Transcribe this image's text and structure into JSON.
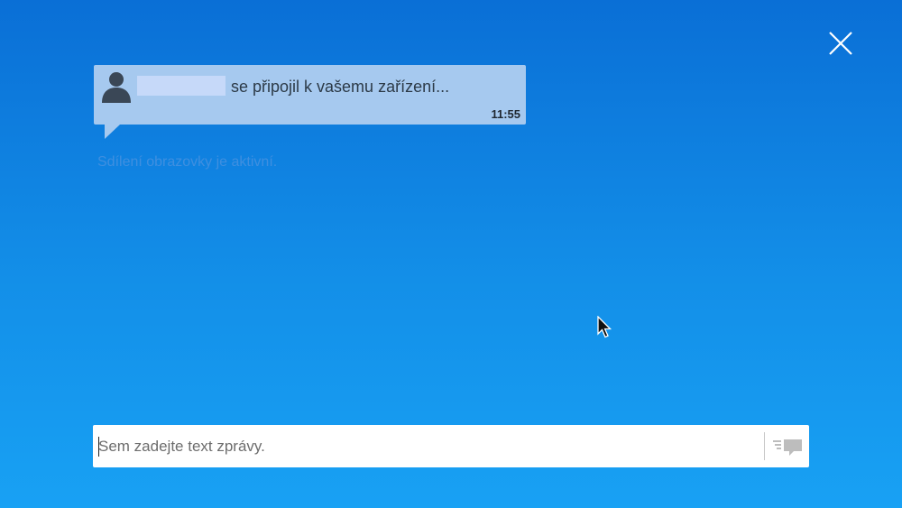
{
  "close": {
    "icon": "close-icon"
  },
  "notification": {
    "avatar_icon": "person-silhouette-icon",
    "message": "se připojil k vašemu zařízení...",
    "time": "11:55"
  },
  "status_text": "Sdílení obrazovky je aktivní.",
  "chat_input": {
    "placeholder": "Sem zadejte text zprávy.",
    "value": ""
  },
  "send": {
    "icon": "send-message-icon"
  },
  "colors": {
    "background_top": "#0a6fd6",
    "background_bottom": "#18a1f4",
    "bubble": "#a6c9ef"
  }
}
